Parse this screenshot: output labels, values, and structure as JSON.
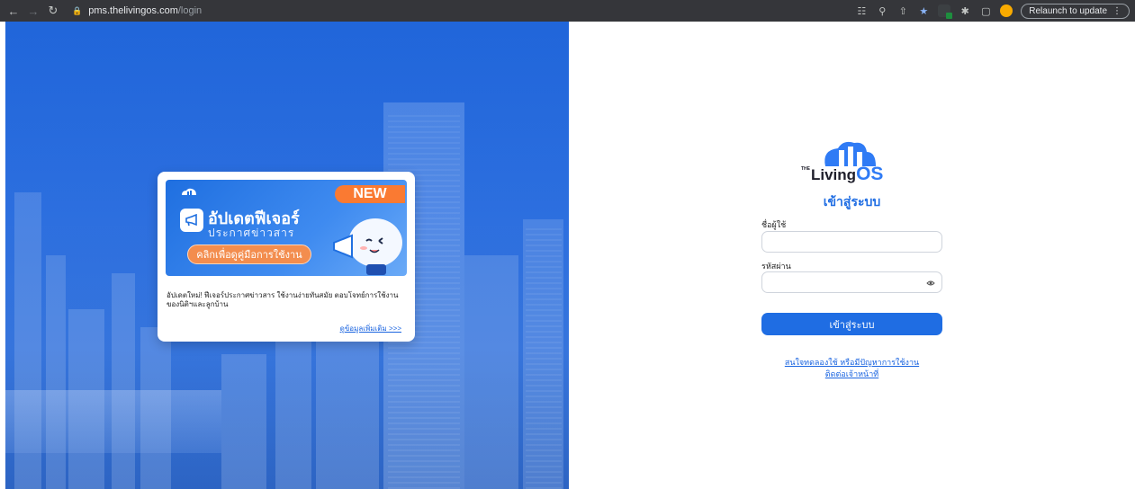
{
  "browser": {
    "url_host": "pms.thelivingos.com",
    "url_path": "/login",
    "relaunch_label": "Relaunch to update"
  },
  "announcement": {
    "badge": "NEW",
    "banner_title": "อัปเดตฟีเจอร์",
    "banner_subtitle": "ประกาศข่าวสาร",
    "banner_button": "คลิกเพื่อดูคู่มือการใช้งาน",
    "description": "อัปเดตใหม่! ฟีเจอร์ประกาศข่าวสาร ใช้งานง่ายทันสมัย ตอบโจทย์การใช้งานของนิติฯและลูกบ้าน",
    "more_link": "ดูข้อมูลเพิ่มเติม >>>",
    "mini_logo_text": "LivingOS"
  },
  "login": {
    "brand_the": "THE",
    "brand_living": "Living",
    "brand_os": "OS",
    "title": "เข้าสู่ระบบ",
    "username_label": "ชื่อผู้ใช้",
    "username_value": "",
    "password_label": "รหัสผ่าน",
    "password_value": "",
    "submit_label": "เข้าสู่ระบบ",
    "help_line1": "สนใจทดลองใช้ หรือมีปัญหาการใช้งาน",
    "help_line2": "ติดต่อเจ้าหน้าที่"
  },
  "colors": {
    "primary": "#1f6de3",
    "accent_orange": "#fa7a32",
    "browser_bar": "#35363a"
  },
  "icons": [
    "back-arrow-icon",
    "forward-arrow-icon",
    "reload-icon",
    "lock-icon",
    "translate-icon",
    "zoom-icon",
    "share-icon",
    "star-icon",
    "extension-icon",
    "puzzle-icon",
    "sidepanel-icon",
    "profile-avatar-icon",
    "megaphone-icon",
    "eye-icon"
  ]
}
